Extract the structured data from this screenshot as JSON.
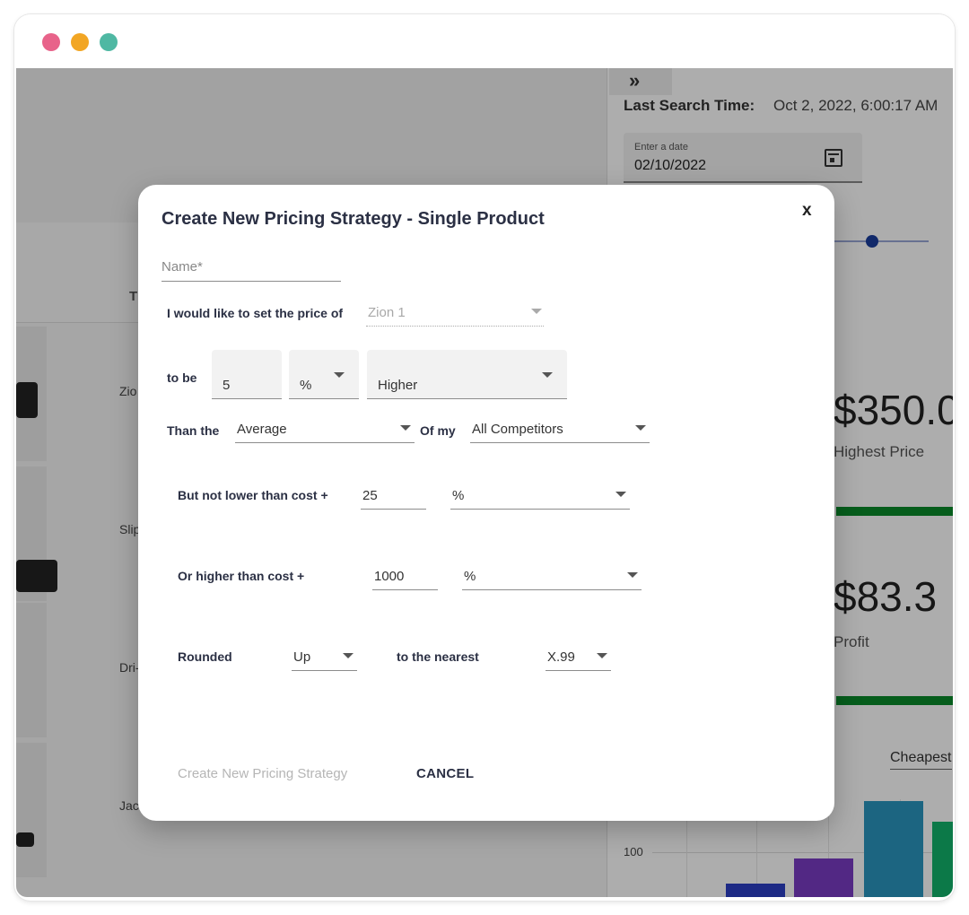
{
  "app": {
    "table_header_fragment": "T",
    "rows": [
      "Zio",
      "Slip",
      "Dri-",
      "Jac"
    ]
  },
  "side_panel": {
    "toggle_icon": "double-chevron-right-icon",
    "last_search_label": "Last Search Time:",
    "last_search_value": "Oct 2, 2022, 6:00:17 AM",
    "date_field_label": "Enter a date",
    "date_field_value": "02/10/2022",
    "highest_price_value": "$350.0",
    "highest_price_label": "Highest Price",
    "profit_value": "$83.3",
    "profit_label": "Profit",
    "sort_select": "Cheapest",
    "chart_tick": "100",
    "colors": {
      "green_bar": "#0a8a2a",
      "bar1": "#2b3fc4",
      "bar2": "#7a3cc3",
      "bar3": "#2a96bf",
      "bar4": "#12b36b"
    }
  },
  "dialog": {
    "title": "Create New Pricing Strategy - Single Product",
    "close_label": "x",
    "name_placeholder": "Name*",
    "price_of_label": "I would like to set the price of",
    "product_value": "Zion 1",
    "to_be_label": "to be",
    "amount_value": "5",
    "unit_value": "%",
    "direction_value": "Higher",
    "than_the_label": "Than the",
    "compare_value": "Average",
    "of_my_label": "Of my",
    "competitors_value": "All Competitors",
    "min_label": "But not lower than cost +",
    "min_value": "25",
    "min_unit": "%",
    "max_label": "Or higher than cost +",
    "max_value": "1000",
    "max_unit": "%",
    "rounded_label": "Rounded",
    "rounded_value": "Up",
    "nearest_label": "to the nearest",
    "nearest_value": "X.99",
    "create_button": "Create New Pricing Strategy",
    "cancel_button": "CANCEL"
  }
}
